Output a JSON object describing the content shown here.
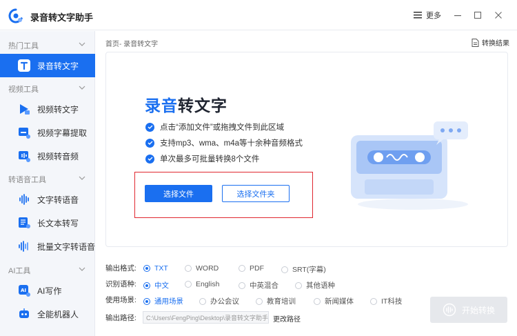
{
  "app": {
    "title": "录音转文字助手"
  },
  "titlebar": {
    "more_label": "更多"
  },
  "sidebar": {
    "sections": [
      {
        "title": "热门工具",
        "items": [
          {
            "label": "录音转文字",
            "active": true
          }
        ]
      },
      {
        "title": "视频工具",
        "items": [
          {
            "label": "视频转文字"
          },
          {
            "label": "视频字幕提取"
          },
          {
            "label": "视频转音频"
          }
        ]
      },
      {
        "title": "转语音工具",
        "items": [
          {
            "label": "文字转语音"
          },
          {
            "label": "长文本转写"
          },
          {
            "label": "批量文字转语音"
          }
        ]
      },
      {
        "title": "AI工具",
        "items": [
          {
            "label": "AI写作"
          },
          {
            "label": "全能机器人"
          }
        ]
      }
    ]
  },
  "main": {
    "breadcrumb": "首页- 录音转文字",
    "results_label": "转换结果",
    "hero": {
      "title_blue": "录音",
      "title_rest": "转文字",
      "features": [
        "点击“添加文件”或拖拽文件到此区域",
        "支持mp3、wma、m4a等十余种音频格式",
        "单次最多可批量转换8个文件"
      ]
    },
    "buttons": {
      "select_file": "选择文件",
      "select_folder": "选择文件夹"
    },
    "options": {
      "format": {
        "label": "输出格式:",
        "choices": [
          "TXT",
          "WORD",
          "PDF",
          "SRT(字幕)"
        ],
        "selected": "TXT"
      },
      "language": {
        "label": "识别语种:",
        "choices": [
          "中文",
          "English",
          "中英混合",
          "其他语种"
        ],
        "selected": "中文"
      },
      "scene": {
        "label": "使用场景:",
        "choices": [
          "通用场景",
          "办公会议",
          "教育培训",
          "新闻媒体",
          "IT科技"
        ],
        "selected": "通用场景"
      },
      "path": {
        "label": "输出路径:",
        "value": "C:\\Users\\FengPing\\Desktop\\录音转文字助手",
        "change_label": "更改路径"
      }
    },
    "start_button": "开始转换"
  },
  "colors": {
    "accent": "#1a6ff0",
    "highlight_box": "#e0262f",
    "disabled": "#e6e8ec"
  }
}
